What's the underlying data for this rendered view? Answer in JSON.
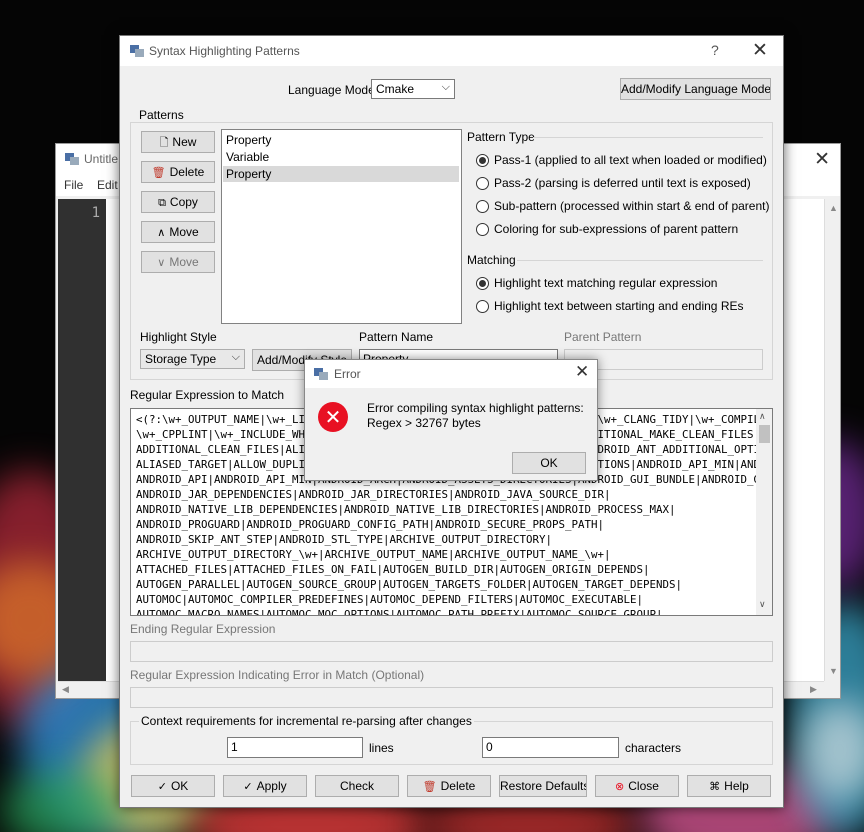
{
  "background_window": {
    "title": "Untitle",
    "menu": [
      "File",
      "Edit"
    ],
    "line_number": "1"
  },
  "dialog": {
    "title": "Syntax Highlighting Patterns",
    "help_glyph": "?",
    "language_mode_label": "Language Mode",
    "language_mode_value": "Cmake",
    "add_modify_language_button": "Add/Modify Language Mode...",
    "patterns_group_label": "Patterns",
    "pattern_buttons": {
      "new": "New",
      "delete": "Delete",
      "copy": "Copy",
      "move_up": "Move",
      "move_down": "Move"
    },
    "pattern_list": [
      "Property",
      "Variable",
      "Property"
    ],
    "selected_pattern_index": 2,
    "pattern_type_label": "Pattern Type",
    "pattern_type_options": [
      "Pass-1 (applied to all text when loaded or modified)",
      "Pass-2 (parsing is deferred until text is exposed)",
      "Sub-pattern (processed within start & end of parent)",
      "Coloring for sub-expressions of parent pattern"
    ],
    "pattern_type_selected": 0,
    "matching_label": "Matching",
    "matching_options": [
      "Highlight text matching regular expression",
      "Highlight text between starting and ending REs"
    ],
    "matching_selected": 0,
    "highlight_style_label": "Highlight Style",
    "highlight_style_value": "Storage Type",
    "add_modify_style_button": "Add/Modify Style",
    "pattern_name_label": "Pattern Name",
    "pattern_name_value": "Property",
    "parent_pattern_label": "Parent Pattern",
    "regex_label": "Regular Expression to Match",
    "regex_lines": [
      "<(?:\\w+_OUTPUT_NAME|\\w+_LINK_INTERFACE_LIBRARIES|\\w+_VISIBILITY_PRESET|\\w+_CLANG_TIDY|\\w+_COMPILER_LAUNCHER|\\w+_CPPCHECK|",
      "\\w+_CPPLINT|\\w+_INCLUDE_WHAT_YOU_USE|\\w+_VISIBILITY_PRESET|ABSTRACT|ADDITIONAL_MAKE_CLEAN_FILES|ADVANCED|ALIAS_GLOBAL|",
      "ADDITIONAL_CLEAN_FILES|ALIASED_TARGET|ALLOW_DUPLICATE_CUSTOM_TARGETS|ANDROID_ANT_ADDITIONAL_OPTIONS|AUTOGEN_EXPORT_ALL_SYMBOLS|",
      "ALIASED_TARGET|ALLOW_DUPLICATE_CUSTOM_TARGETS|ANDROID_ANT_ADDITIONAL_OPTIONS|ANDROID_API_MIN|ANDROID_ANT_ADDITIONAL_OPTIONS|",
      "ANDROID_API|ANDROID_API_MIN|ANDROID_ARCH|ANDROID_ASSETS_DIRECTORIES|ANDROID_GUI_BUNDLE|ANDROID_GUI_BUNDLE_EXECUTABLES|ANDROID_GUI|",
      "ANDROID_JAR_DEPENDENCIES|ANDROID_JAR_DIRECTORIES|ANDROID_JAVA_SOURCE_DIR|",
      "ANDROID_NATIVE_LIB_DEPENDENCIES|ANDROID_NATIVE_LIB_DIRECTORIES|ANDROID_PROCESS_MAX|",
      "ANDROID_PROGUARD|ANDROID_PROGUARD_CONFIG_PATH|ANDROID_SECURE_PROPS_PATH|",
      "ANDROID_SKIP_ANT_STEP|ANDROID_STL_TYPE|ARCHIVE_OUTPUT_DIRECTORY|",
      "ARCHIVE_OUTPUT_DIRECTORY_\\w+|ARCHIVE_OUTPUT_NAME|ARCHIVE_OUTPUT_NAME_\\w+|",
      "ATTACHED_FILES|ATTACHED_FILES_ON_FAIL|AUTOGEN_BUILD_DIR|AUTOGEN_ORIGIN_DEPENDS|",
      "AUTOGEN_PARALLEL|AUTOGEN_SOURCE_GROUP|AUTOGEN_TARGETS_FOLDER|AUTOGEN_TARGET_DEPENDS|",
      "AUTOMOC|AUTOMOC_COMPILER_PREDEFINES|AUTOMOC_DEPEND_FILTERS|AUTOMOC_EXECUTABLE|",
      "AUTOMOC_MACRO_NAMES|AUTOMOC_MOC_OPTIONS|AUTOMOC_PATH_PREFIX|AUTOMOC_SOURCE_GROUP|"
    ],
    "ending_regex_label": "Ending Regular Expression",
    "error_regex_label": "Regular Expression Indicating Error in Match (Optional)",
    "context_label": "Context requirements for incremental re-parsing after changes",
    "lines_value": "1",
    "lines_label": "lines",
    "characters_value": "0",
    "characters_label": "characters",
    "bottom_buttons": {
      "ok": "OK",
      "apply": "Apply",
      "check": "Check",
      "delete": "Delete",
      "restore_defaults": "Restore Defaults",
      "close": "Close",
      "help": "Help"
    }
  },
  "error_dialog": {
    "title": "Error",
    "message_line1": "Error compiling syntax highlight patterns:",
    "message_line2": "Regex > 32767 bytes",
    "ok_button": "OK"
  },
  "colors": {
    "error_icon": "#e81123",
    "selected_row": "#d9d9d9",
    "dialog_bg": "#f0f0f0"
  }
}
